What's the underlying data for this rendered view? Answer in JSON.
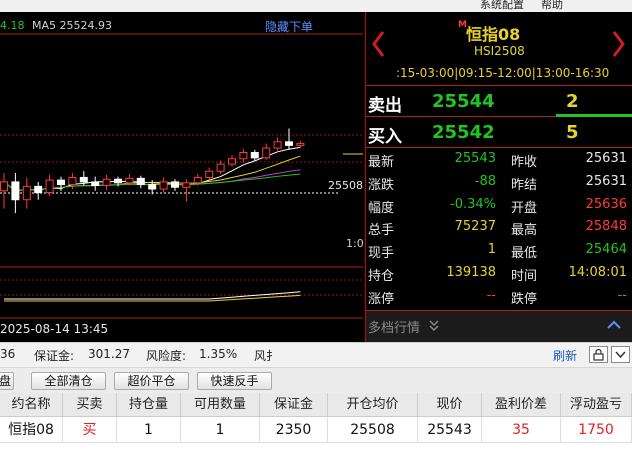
{
  "colors": {
    "up": "#ff3b3b",
    "down": "#22c322",
    "yellow": "#e7d22d",
    "accent": "#cc0000",
    "bg": "#000000"
  },
  "menu": {
    "item1": "系统配置",
    "item2": "帮助"
  },
  "chart": {
    "ma_prefix": "4.18",
    "ma5_label": "MA5 25524.93",
    "hide_orders": "隐藏下单",
    "price_line_label": "25508",
    "ratio_label": "1:0",
    "datetime": "2025-08-14 13:45",
    "candles": [
      {
        "o": 25490,
        "c": 25500,
        "h": 25510,
        "l": 25470
      },
      {
        "o": 25500,
        "c": 25480,
        "h": 25510,
        "l": 25465
      },
      {
        "o": 25480,
        "c": 25495,
        "h": 25505,
        "l": 25470
      },
      {
        "o": 25495,
        "c": 25488,
        "h": 25500,
        "l": 25480
      },
      {
        "o": 25488,
        "c": 25502,
        "h": 25508,
        "l": 25484
      },
      {
        "o": 25502,
        "c": 25497,
        "h": 25506,
        "l": 25490
      },
      {
        "o": 25497,
        "c": 25505,
        "h": 25510,
        "l": 25492
      },
      {
        "o": 25505,
        "c": 25500,
        "h": 25512,
        "l": 25496
      },
      {
        "o": 25500,
        "c": 25496,
        "h": 25506,
        "l": 25490
      },
      {
        "o": 25496,
        "c": 25503,
        "h": 25508,
        "l": 25491
      },
      {
        "o": 25503,
        "c": 25499,
        "h": 25506,
        "l": 25495
      },
      {
        "o": 25499,
        "c": 25504,
        "h": 25509,
        "l": 25496
      },
      {
        "o": 25504,
        "c": 25497,
        "h": 25507,
        "l": 25493
      },
      {
        "o": 25497,
        "c": 25492,
        "h": 25502,
        "l": 25486
      },
      {
        "o": 25492,
        "c": 25500,
        "h": 25505,
        "l": 25488
      },
      {
        "o": 25500,
        "c": 25494,
        "h": 25503,
        "l": 25490
      },
      {
        "o": 25494,
        "c": 25499,
        "h": 25503,
        "l": 25478
      },
      {
        "o": 25499,
        "c": 25505,
        "h": 25509,
        "l": 25496
      },
      {
        "o": 25505,
        "c": 25512,
        "h": 25516,
        "l": 25503
      },
      {
        "o": 25512,
        "c": 25520,
        "h": 25524,
        "l": 25509
      },
      {
        "o": 25520,
        "c": 25526,
        "h": 25530,
        "l": 25517
      },
      {
        "o": 25526,
        "c": 25533,
        "h": 25537,
        "l": 25522
      },
      {
        "o": 25533,
        "c": 25527,
        "h": 25536,
        "l": 25524
      },
      {
        "o": 25527,
        "c": 25538,
        "h": 25543,
        "l": 25525
      },
      {
        "o": 25538,
        "c": 25545,
        "h": 25550,
        "l": 25535
      },
      {
        "o": 25545,
        "c": 25541,
        "h": 25560,
        "l": 25536
      },
      {
        "o": 25541,
        "c": 25543,
        "h": 25546,
        "l": 25538
      }
    ]
  },
  "quote": {
    "marker": "M",
    "name": "恒指08",
    "code": "HSI2508",
    "session_times": ":15-03:00|09:15-12:00|13:00-16:30",
    "sell_label": "卖出",
    "sell_price": "25544",
    "sell_qty": "2",
    "buy_label": "买入",
    "buy_price": "25542",
    "buy_qty": "5",
    "rows": [
      {
        "l1": "最新",
        "v1": "25543",
        "c1": "down",
        "l2": "昨收",
        "v2": "25631",
        "c2": "white"
      },
      {
        "l1": "涨跌",
        "v1": "-88",
        "c1": "down",
        "l2": "昨结",
        "v2": "25631",
        "c2": "white"
      },
      {
        "l1": "幅度",
        "v1": "-0.34%",
        "c1": "down",
        "l2": "开盘",
        "v2": "25636",
        "c2": "up"
      },
      {
        "l1": "总手",
        "v1": "75237",
        "c1": "yellow",
        "l2": "最高",
        "v2": "25848",
        "c2": "up"
      },
      {
        "l1": "现手",
        "v1": "1",
        "c1": "yellow",
        "l2": "最低",
        "v2": "25464",
        "c2": "down"
      },
      {
        "l1": "持仓",
        "v1": "139138",
        "c1": "yellow",
        "l2": "时间",
        "v2": "14:08:01",
        "c2": "yellow"
      },
      {
        "l1": "涨停",
        "v1": "--",
        "c1": "up",
        "l2": "跌停",
        "v2": "--",
        "c2": "down"
      }
    ],
    "depth_label": "多档行情"
  },
  "account": {
    "prefix": "36",
    "margin_label": "保证金:",
    "margin_value": "301.27",
    "risk_label": "风险度:",
    "risk_value": "1.35%",
    "cut_label": "风扌",
    "refresh": "刷新"
  },
  "toolbar": {
    "left_stub": "盘",
    "btn1": "全部清仓",
    "btn2": "超价平仓",
    "btn3": "快速反手"
  },
  "table": {
    "headers": [
      "约名称",
      "买卖",
      "持仓量",
      "可用数量",
      "保证金",
      "开仓均价",
      "现价",
      "盈利价差",
      "浮动盈亏"
    ],
    "rows": [
      [
        "恒指08",
        "买",
        "1",
        "1",
        "2350",
        "25508",
        "25543",
        "35",
        "1750"
      ]
    ]
  }
}
